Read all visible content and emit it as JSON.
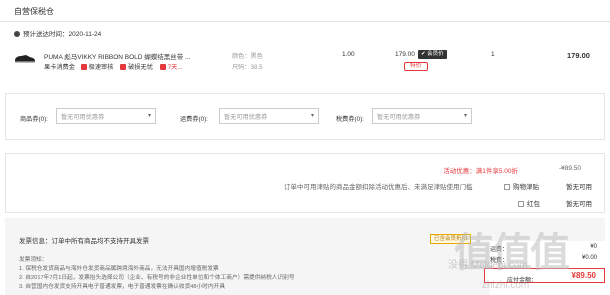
{
  "section_title": "自营保税仓",
  "shipping": {
    "label": "预计送达时间：",
    "date": "2020-11-24"
  },
  "item": {
    "title": "PUMA 彪马VIKKY RIBBON BOLD 蝴蝶结黑丝带 ...",
    "tags": [
      {
        "text": "果卡消费金",
        "style": "plain"
      },
      {
        "text": "极速审核",
        "style": "red"
      },
      {
        "text": "破损无忧",
        "style": "red"
      },
      {
        "text": "7天...",
        "style": "red"
      }
    ],
    "color": "颜色：黑色",
    "size": "尺码：38.5",
    "qty_a": "1.00",
    "price": "179.00",
    "badge_dark": "✔ 会员价",
    "badge_outline": "特价",
    "qty_b": "1",
    "subtotal": "179.00",
    "icon": "shoe-icon"
  },
  "coupons": {
    "product": {
      "label": "商品券(0):",
      "placeholder": "暂无可用优惠券"
    },
    "shipping": {
      "label": "运费券(0):",
      "placeholder": "暂无可用优惠券"
    },
    "tax": {
      "label": "税费券(0):",
      "placeholder": "暂无可用优惠券"
    }
  },
  "summary": {
    "promo": "活动优惠：满1件享5.00折",
    "promo_amount": "-¥89.50",
    "note": "订单中可用津贴的商品金额扣除活动优惠后、未满足津贴使用门槛",
    "shop_allowance": "购物津贴",
    "red_packet": "红包",
    "not_available_1": "暂无可用",
    "not_available_2": "暂无可用"
  },
  "invoice": {
    "heading": "发票信息：订单中所有商品均不支持开具发票",
    "notes": [
      "发票须知：",
      "1. 保税仓发货商品与海外仓发货商品属跨境海外商品，无法开具国内增值税发票",
      "2. 自2017年7月1日起，发票抬头选择公司（企业、有税号的非企业性单位和个体工商户）需提供纳税人识别号",
      "3. 自营国内仓发货支持开具电子普通发票，电子普通发票在确认收货48小时内开具"
    ]
  },
  "totals": {
    "member_badge": "已含会员折扣",
    "shipping_label": "运费：",
    "shipping_value": "¥0",
    "tax_label": "税费：",
    "tax_value": "¥0.00",
    "pay_label": "应付金额：",
    "pay_value": "¥89.50"
  },
  "watermark": {
    "big": "值值值",
    "small": "没得 Meldebi.com",
    "url": "zhizhi.com"
  },
  "colors": {
    "accent": "#e4393c",
    "border": "#e6e6e6",
    "panel": "#f5f5f5"
  }
}
